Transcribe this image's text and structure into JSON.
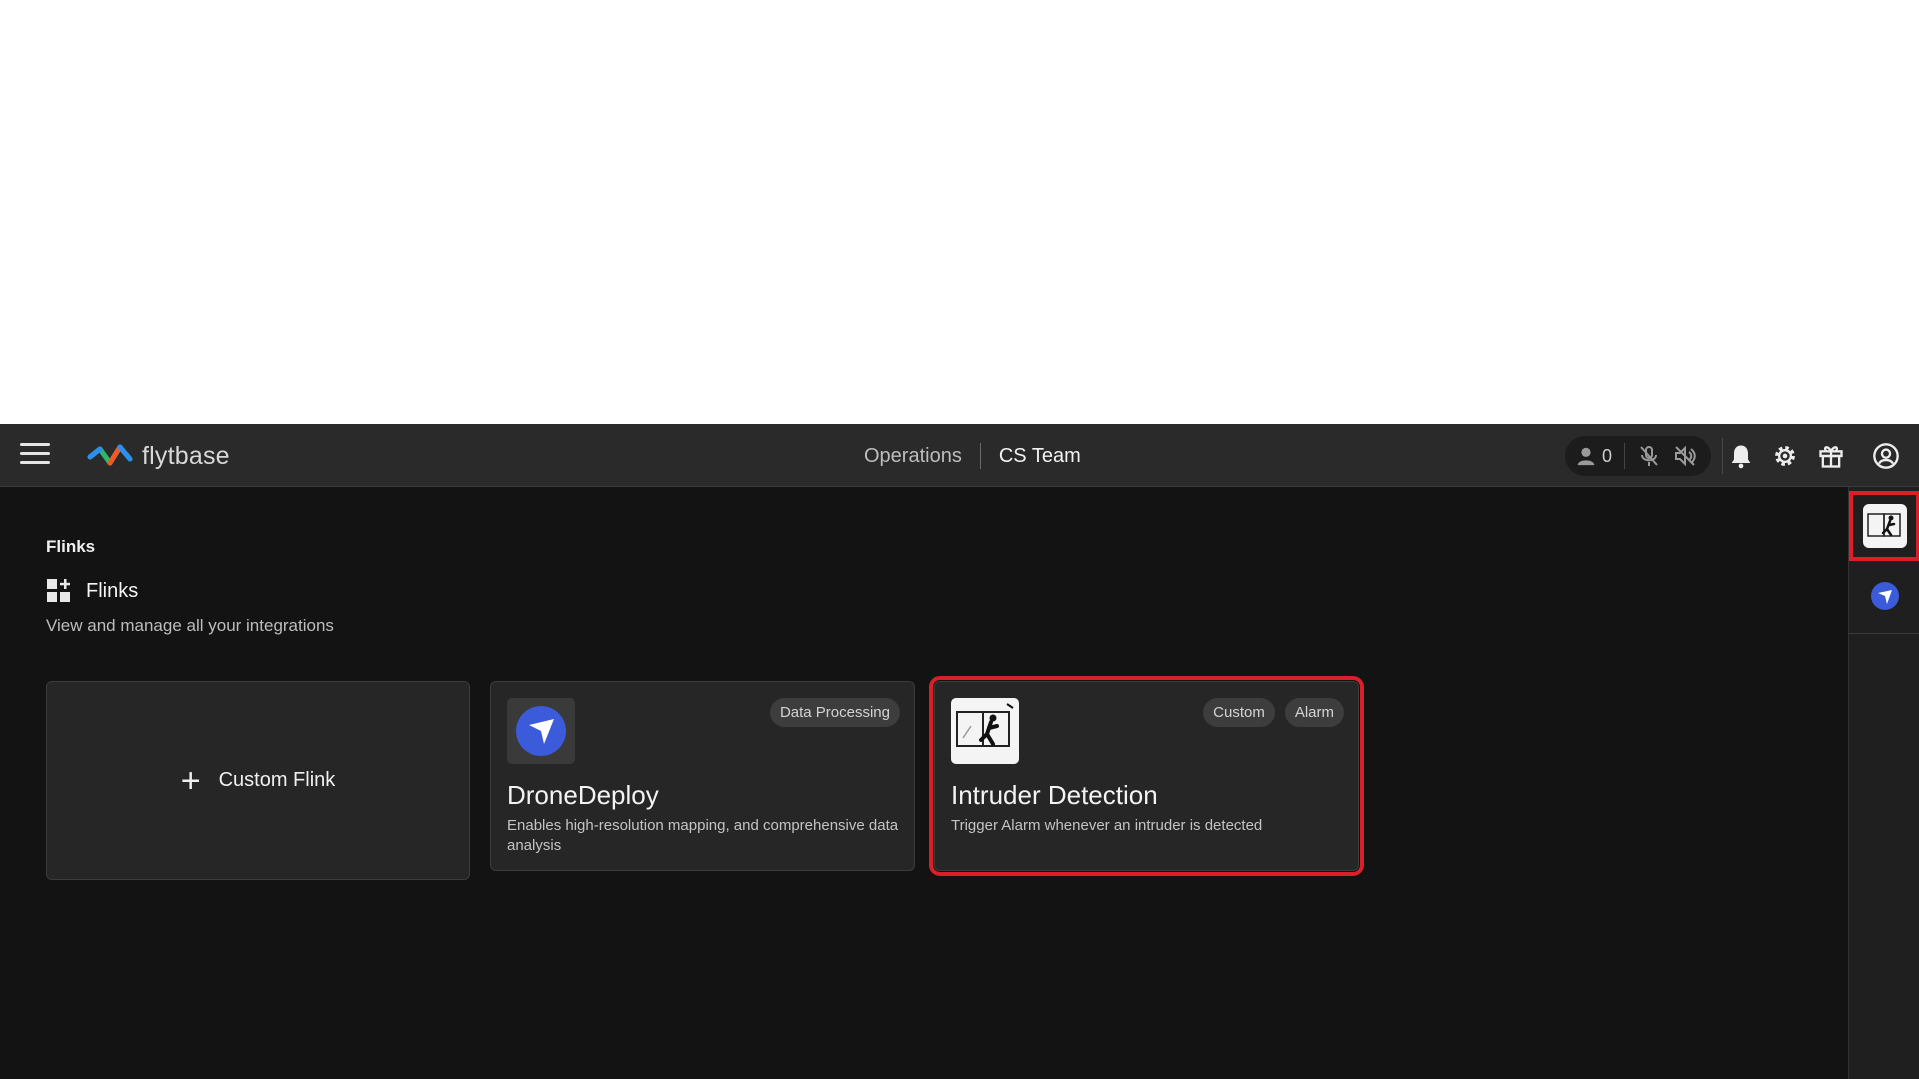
{
  "topbar": {
    "logo_text": "flytbase",
    "breadcrumb": {
      "workspace": "Operations",
      "team": "CS Team"
    },
    "user_count": "0"
  },
  "page": {
    "section_title": "Flinks",
    "heading": "Flinks",
    "subtitle": "View and manage all your integrations"
  },
  "cards": {
    "custom": {
      "label": "Custom Flink"
    },
    "dronedeploy": {
      "name": "DroneDeploy",
      "description": "Enables high-resolution mapping, and comprehensive data analysis",
      "tags": [
        "Data Processing"
      ]
    },
    "intruder": {
      "name": "Intruder Detection",
      "description": "Trigger Alarm whenever an intruder is detected",
      "tags": [
        "Custom",
        "Alarm"
      ]
    }
  },
  "colors": {
    "accent_blue": "#3b5bdb",
    "highlight_red": "#d9202a"
  },
  "icons": [
    "menu-icon",
    "user-icon",
    "mic-off-icon",
    "speaker-off-icon",
    "bell-icon",
    "gear-icon",
    "gift-icon",
    "account-icon",
    "grid-icon",
    "plus-icon",
    "dronedeploy-icon",
    "intruder-icon"
  ]
}
